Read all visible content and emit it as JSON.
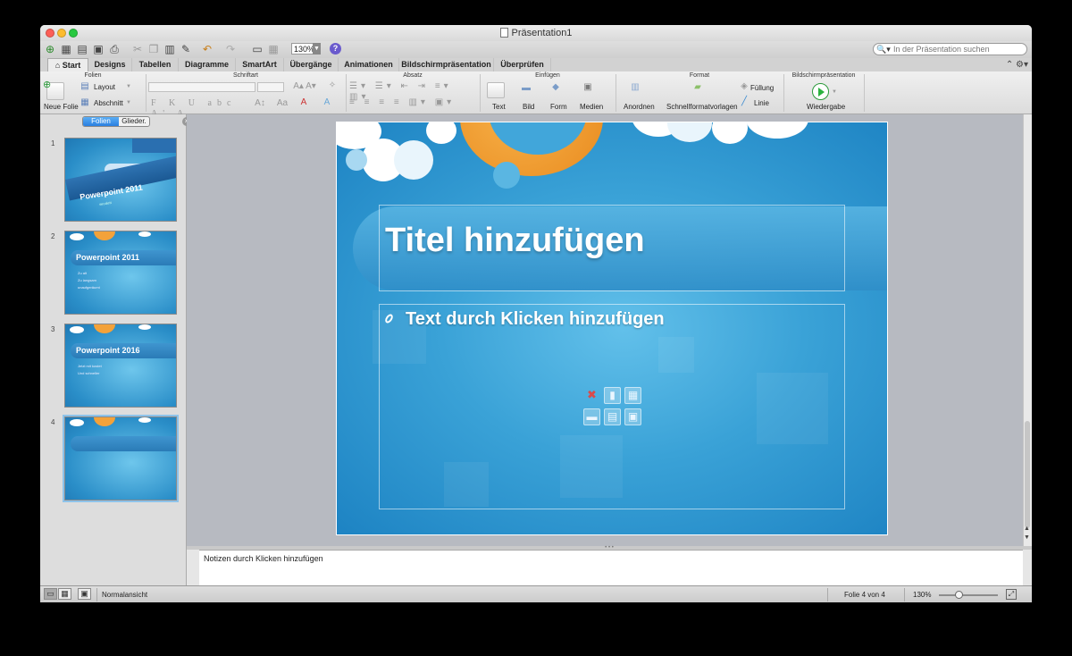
{
  "window": {
    "title": "Präsentation1"
  },
  "colors": {
    "accent": "#2a7fe0",
    "slide_blue": "#3aa2d7",
    "sun": "#f3a23a",
    "play_green": "#2bb23f"
  },
  "toolbar": {
    "icons": [
      "new-icon",
      "templates-icon",
      "open-icon",
      "save-icon",
      "print-icon",
      "cut-icon",
      "copy-icon",
      "paste-icon",
      "format-painter-icon",
      "undo-icon",
      "redo-icon",
      "slide-icon",
      "table-icon"
    ],
    "zoom": "130%",
    "search_placeholder": "In der Präsentation suchen"
  },
  "tabs": [
    "Start",
    "Designs",
    "Tabellen",
    "Diagramme",
    "SmartArt",
    "Übergänge",
    "Animationen",
    "Bildschirmpräsentation",
    "Überprüfen"
  ],
  "ribbon": {
    "groups": {
      "folien": "Folien",
      "schriftart": "Schriftart",
      "absatz": "Absatz",
      "einfuegen": "Einfügen",
      "format": "Format",
      "bildschirm": "Bildschirmpräsentation"
    },
    "neue_folie": "Neue Folie",
    "layout": "Layout",
    "abschnitt": "Abschnitt",
    "text": "Text",
    "bild": "Bild",
    "form": "Form",
    "medien": "Medien",
    "anordnen": "Anordnen",
    "schnellformat": "Schnellformatvorlagen",
    "fuellung": "Füllung",
    "linie": "Linie",
    "wiedergabe": "Wiedergabe"
  },
  "sidebar": {
    "tab_folien": "Folien",
    "tab_glieder": "Glieder.",
    "slides": [
      {
        "num": "1",
        "title": "Powerpoint 2011",
        "sub": "secalett"
      },
      {
        "num": "2",
        "title": "Powerpoint 2011",
        "bullets": [
          "Zu alt",
          "Zu langsam",
          "unaufgeräumt"
        ]
      },
      {
        "num": "3",
        "title": "Powerpoint 2016",
        "bullets": [
          "Jetzt mit kostet",
          "Und schneller"
        ]
      },
      {
        "num": "4",
        "title": ""
      }
    ]
  },
  "slide": {
    "title": "Titel hinzufügen",
    "body": "Text durch Klicken hinzufügen"
  },
  "notes": {
    "placeholder": "Notizen durch Klicken hinzufügen"
  },
  "status": {
    "view": "Normalansicht",
    "slide_of": "Folie 4 von 4",
    "zoom": "130%"
  }
}
